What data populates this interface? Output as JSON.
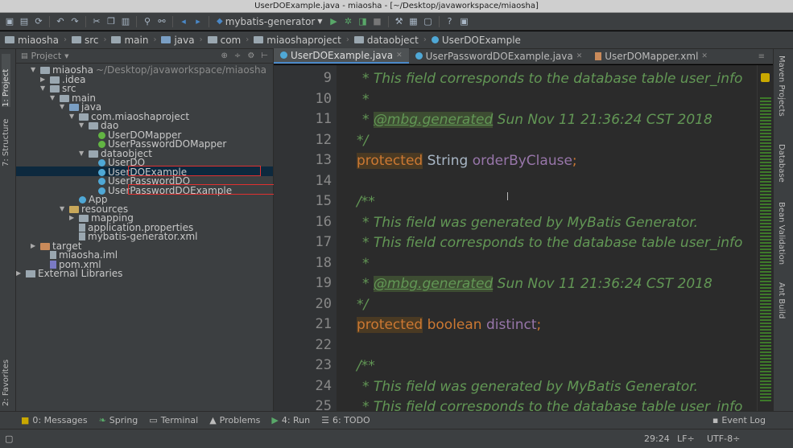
{
  "window": {
    "title": "UserDOExample.java - miaosha - [~/Desktop/javaworkspace/miaosha]"
  },
  "toolbar": {
    "run_config": "mybatis-generator"
  },
  "breadcrumb": [
    "miaosha",
    "src",
    "main",
    "java",
    "com",
    "miaoshaproject",
    "dataobject",
    "UserDOExample"
  ],
  "left_tabs": {
    "project": "1: Project",
    "structure": "7: Structure",
    "favorites": "2: Favorites"
  },
  "right_tabs": {
    "maven": "Maven Projects",
    "database": "Database",
    "bean": "Bean Validation",
    "ant": "Ant Build"
  },
  "project_panel": {
    "title": "Project"
  },
  "tree": [
    {
      "label": "miaosha",
      "extra": "~/Desktop/javaworkspace/miaosha"
    },
    {
      "label": ".idea"
    },
    {
      "label": "src"
    },
    {
      "label": "main"
    },
    {
      "label": "java"
    },
    {
      "label": "com.miaoshaproject"
    },
    {
      "label": "dao"
    },
    {
      "label": "UserDOMapper"
    },
    {
      "label": "UserPasswordDOMapper"
    },
    {
      "label": "dataobject"
    },
    {
      "label": "UserDO"
    },
    {
      "label": "UserDOExample"
    },
    {
      "label": "UserPasswordDO"
    },
    {
      "label": "UserPasswordDOExample"
    },
    {
      "label": "App"
    },
    {
      "label": "resources"
    },
    {
      "label": "mapping"
    },
    {
      "label": "application.properties"
    },
    {
      "label": "mybatis-generator.xml"
    },
    {
      "label": "target"
    },
    {
      "label": "miaosha.iml"
    },
    {
      "label": "pom.xml"
    },
    {
      "label": "External Libraries"
    }
  ],
  "editor_tabs": [
    {
      "label": "UserDOExample.java"
    },
    {
      "label": "UserPasswordDOExample.java"
    },
    {
      "label": "UserDOMapper.xml"
    }
  ],
  "line_numbers": [
    "9",
    "10",
    "11",
    "12",
    "13",
    "14",
    "15",
    "16",
    "17",
    "18",
    "19",
    "20",
    "21",
    "22",
    "23",
    "24",
    "25"
  ],
  "code": {
    "l9": "* This field corresponds to the database table user_info",
    "l10": "*",
    "l11_star": "* ",
    "l11_tag": "@mbg.generated",
    "l11_rest": " Sun Nov 11 21:36:24 CST 2018",
    "l12": "*/",
    "l13_kw": "protected",
    "l13_type": " String ",
    "l13_field": "orderByClause",
    "l13_end": ";",
    "l15": "/**",
    "l16": "* This field was generated by MyBatis Generator.",
    "l17": "* This field corresponds to the database table user_info",
    "l18": "*",
    "l19_star": "* ",
    "l19_tag": "@mbg.generated",
    "l19_rest": " Sun Nov 11 21:36:24 CST 2018",
    "l20": "*/",
    "l21_kw": "protected",
    "l21_type": " boolean ",
    "l21_field": "distinct",
    "l21_end": ";",
    "l23": "/**",
    "l24": "* This field was generated by MyBatis Generator.",
    "l25": "* This field corresponds to the database table user_info"
  },
  "bottom_tools": {
    "messages": "0: Messages",
    "spring": "Spring",
    "terminal": "Terminal",
    "problems": "Problems",
    "run": "4: Run",
    "todo": "6: TODO",
    "event_log": "Event Log"
  },
  "status": {
    "position": "29:24",
    "line_sep": "LF÷",
    "encoding": "UTF-8÷"
  }
}
